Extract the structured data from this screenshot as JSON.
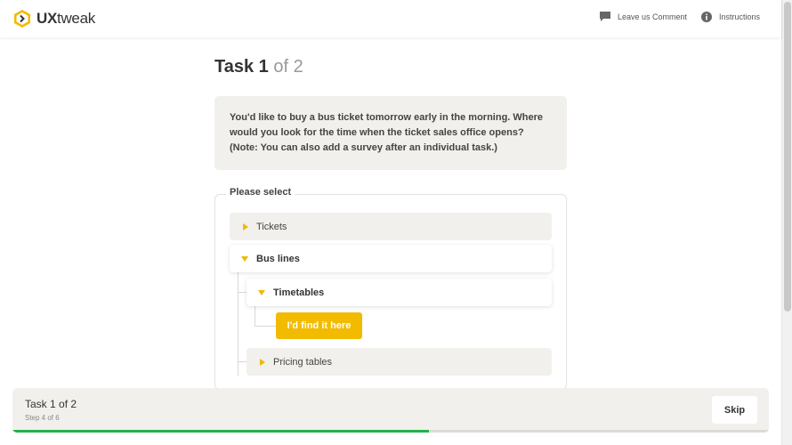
{
  "header": {
    "brand_bold": "UX",
    "brand_rest": "tweak",
    "comment_label": "Leave us Comment",
    "instructions_label": "Instructions"
  },
  "task": {
    "title_word": "Task",
    "title_num": "1",
    "title_of": "of 2",
    "description": "You'd like to buy a bus ticket tomorrow early in the morning. Where would you look for the time when the ticket sales office opens? (Note: You can also add a survey after an individual task.)"
  },
  "tree": {
    "legend": "Please select",
    "items": [
      {
        "label": "Tickets",
        "state": "closed"
      },
      {
        "label": "Bus lines",
        "state": "open"
      },
      {
        "label": "Timetables",
        "state": "open"
      },
      {
        "label": "Pricing tables",
        "state": "closed"
      }
    ],
    "find_button": "I'd find it here"
  },
  "footer": {
    "title": "Task 1 of 2",
    "step": "Step 4 of 6",
    "skip": "Skip",
    "progress": 0.55
  },
  "colors": {
    "accent": "#f2bb00",
    "progress": "#22b14c",
    "panel": "#f1f0ec"
  },
  "icons": [
    "uxtweak-logo-icon",
    "comment-icon",
    "info-icon",
    "caret-right-icon",
    "caret-down-icon"
  ]
}
